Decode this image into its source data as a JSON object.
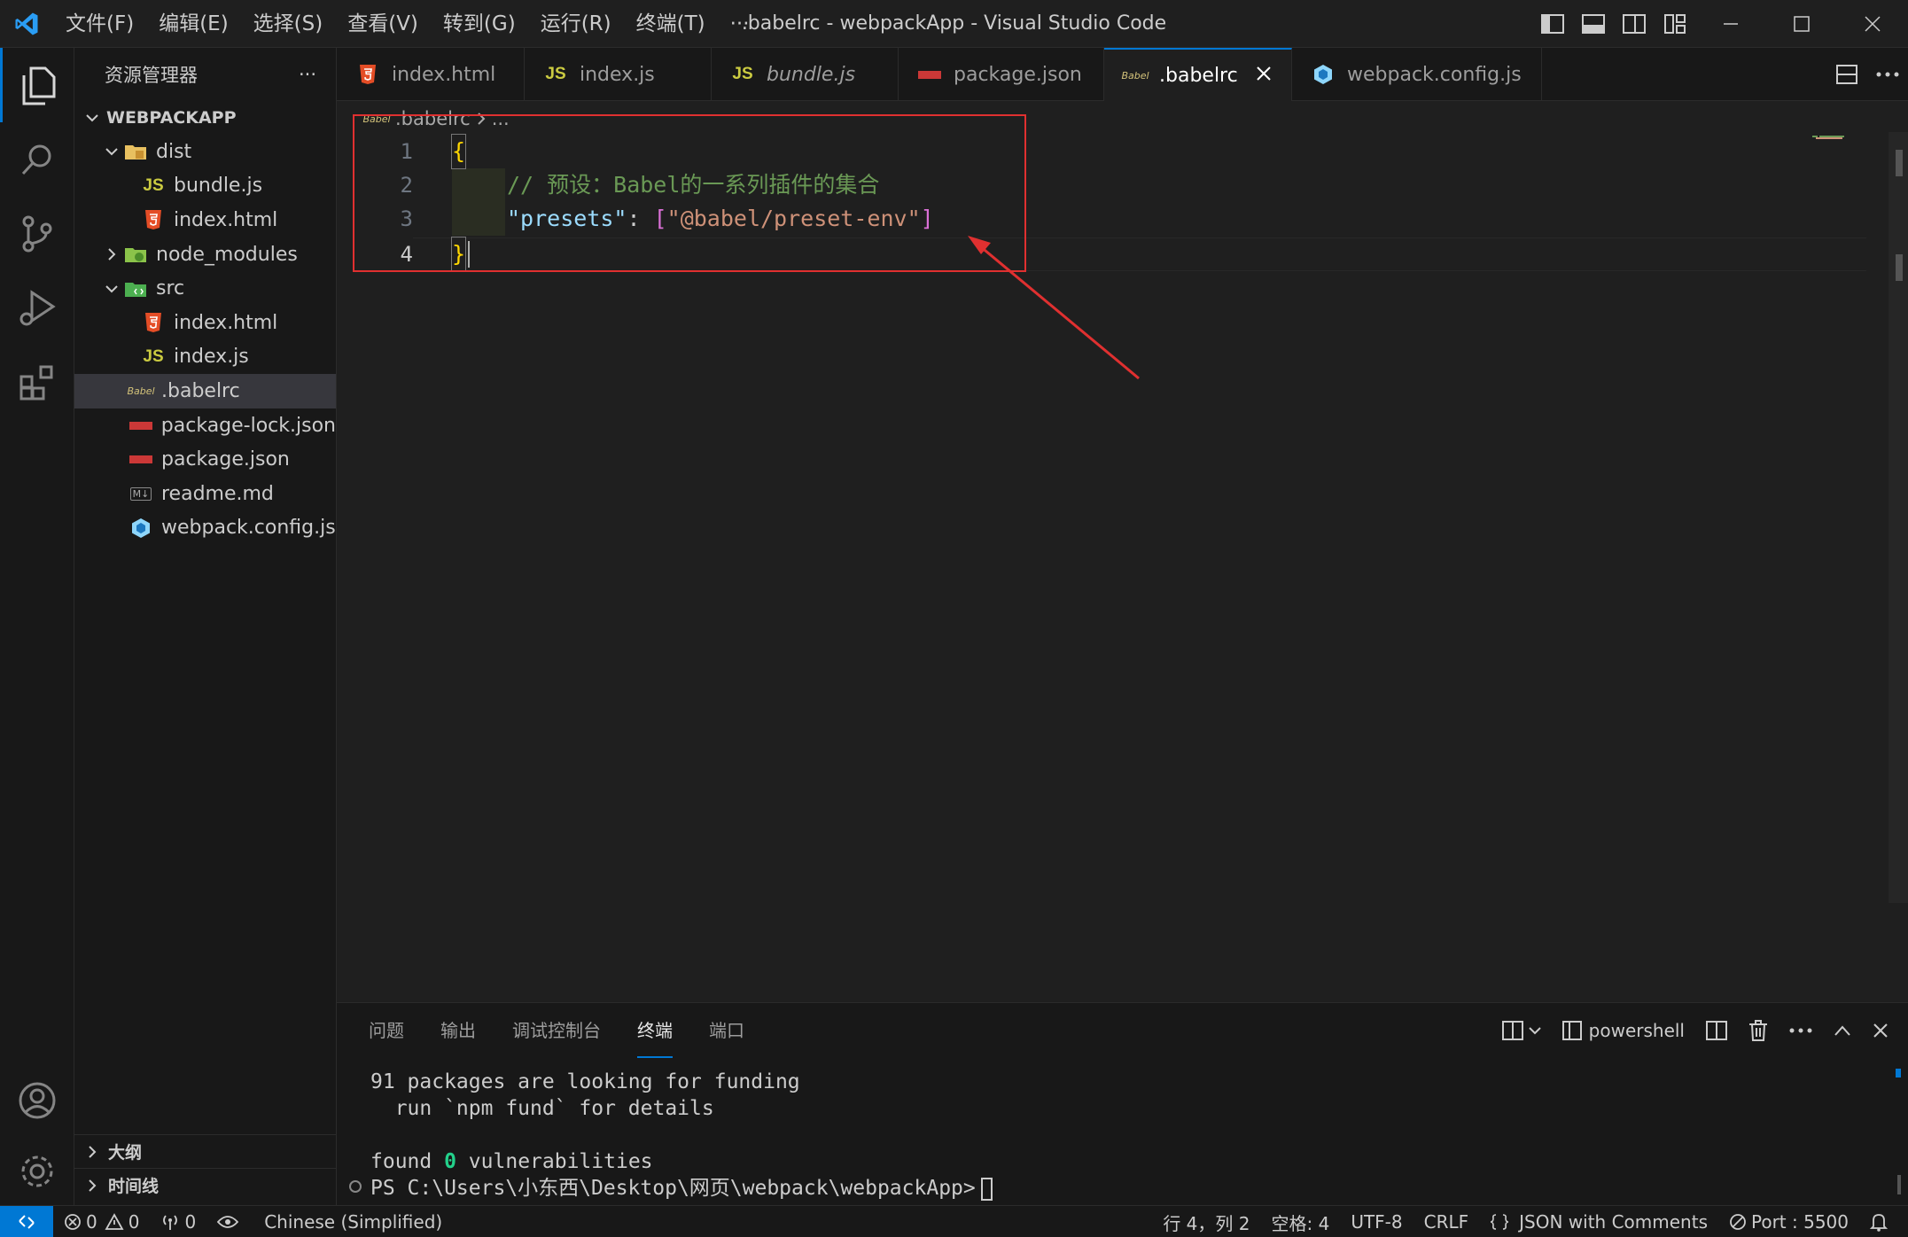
{
  "titlebar": {
    "menu": [
      "文件(F)",
      "编辑(E)",
      "选择(S)",
      "查看(V)",
      "转到(G)",
      "运行(R)",
      "终端(T)",
      "···"
    ],
    "window_title": ".babelrc - webpackApp - Visual Studio Code"
  },
  "sidebar": {
    "header": "资源管理器",
    "more": "···",
    "root": "WEBPACKAPP",
    "items": [
      {
        "label": "dist",
        "icon": "folder-icon"
      },
      {
        "label": "bundle.js",
        "icon": "js-file-icon"
      },
      {
        "label": "index.html",
        "icon": "html-file-icon"
      },
      {
        "label": "node_modules",
        "icon": "folder-node-icon"
      },
      {
        "label": "src",
        "icon": "folder-src-icon"
      },
      {
        "label": "index.html",
        "icon": "html-file-icon"
      },
      {
        "label": "index.js",
        "icon": "js-file-icon"
      },
      {
        "label": ".babelrc",
        "icon": "babel-file-icon"
      },
      {
        "label": "package-lock.json",
        "icon": "npm-file-icon"
      },
      {
        "label": "package.json",
        "icon": "npm-file-icon"
      },
      {
        "label": "readme.md",
        "icon": "markdown-file-icon"
      },
      {
        "label": "webpack.config.js",
        "icon": "webpack-file-icon"
      }
    ],
    "outline": "大纲",
    "timeline": "时间线"
  },
  "tabs": [
    {
      "label": "index.html"
    },
    {
      "label": "index.js"
    },
    {
      "label": "bundle.js"
    },
    {
      "label": "package.json"
    },
    {
      "label": ".babelrc"
    },
    {
      "label": "webpack.config.js"
    }
  ],
  "editor": {
    "breadcrumb_file": ".babelrc",
    "breadcrumb_rest": "...",
    "line_numbers": [
      "1",
      "2",
      "3",
      "4"
    ],
    "lines": {
      "l1_brace": "{",
      "l2_comment": "// 预设：Babel的一系列插件的集合",
      "l3_key": "\"presets\"",
      "l3_colon": ": ",
      "l3_open": "[",
      "l3_value": "\"@babel/preset-env\"",
      "l3_close": "]",
      "l4_brace": "}"
    }
  },
  "panel": {
    "tabs": [
      "问题",
      "输出",
      "调试控制台",
      "终端",
      "端口"
    ],
    "shell": "powershell",
    "terminal": {
      "line1": "91 packages are looking for funding",
      "line2": "  run `npm fund` for details",
      "line3_pre": "found ",
      "line3_num": "0",
      "line3_post": " vulnerabilities",
      "prompt": "PS C:\\Users\\小东西\\Desktop\\网页\\webpack\\webpackApp>"
    }
  },
  "statusbar": {
    "errors": "0",
    "warnings": "0",
    "ports_forwarded": "0",
    "language_pack": "Chinese (Simplified)",
    "position": "行 4，列 2",
    "spaces": "空格: 4",
    "encoding": "UTF-8",
    "eol": "CRLF",
    "language": "JSON with Comments",
    "port": "Port : 5500"
  },
  "colors": {
    "accent": "#0078d4",
    "annotation_red": "#e03030"
  }
}
